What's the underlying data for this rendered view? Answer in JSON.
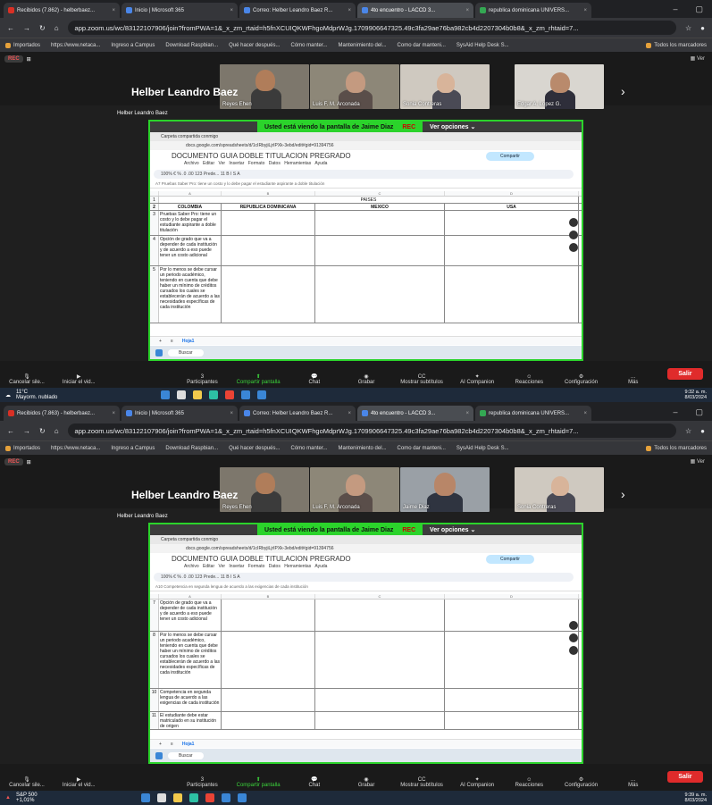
{
  "tabs": [
    {
      "label": "Recibidos (7.862) - helberbaez..."
    },
    {
      "label": "Inicio | Microsoft 365"
    },
    {
      "label": "Correo: Helber Leandro Baez R..."
    },
    {
      "label": "4to encuentro - LACCD 3..."
    },
    {
      "label": "republica dominicana UNIVERS..."
    }
  ],
  "tabs2": [
    {
      "label": "Recibidos (7.863) - helberbaez..."
    },
    {
      "label": "Inicio | Microsoft 365"
    },
    {
      "label": "Correo: Helber Leandro Baez R..."
    },
    {
      "label": "4to encuentro - LACCD 3..."
    },
    {
      "label": "republica dominicana UNIVERS..."
    }
  ],
  "url": "app.zoom.us/wc/83122107906/join?fromPWA=1&_x_zm_rtaid=h5fnXCUIQKWFhgoMdprWJg.1709906647325.49c3fa29ae76ba982cb4d2207304b0b8&_x_zm_rhtaid=7...",
  "bookmarks": [
    "Importados",
    "https://www.netaca...",
    "Ingreso a Campus",
    "Download Raspbian...",
    "Qué hacer después...",
    "Cómo manter...",
    "Mantenimiento del...",
    "Como dar manteni...",
    "SysAid Help Desk S...",
    "Todos los marcadores"
  ],
  "rec": "REC",
  "ver": "Ver",
  "host": "Helber Leandro Baez",
  "host_small": "Helber Leandro Baez",
  "tiles1": [
    "Reyes Ehen",
    "Luis F. M. Arconada",
    "Sonia Contreras",
    "Edgar A. Lopez G."
  ],
  "tiles2": [
    "Reyes Ehen",
    "Luis F. M. Arconada",
    "Jaime Diaz",
    "Sonia Contreras"
  ],
  "share_label": "Usted está viendo la pantalla de Jaime Diaz",
  "share_rec": "REC",
  "ver_opciones": "Ver opciones",
  "inner_tab": "Carpeta compartida conmigo",
  "inner_url": "docs.google.com/spreadsheets/d/1cIRbyjiLjrIPXk-3ebd/edit#gid=91394756",
  "doc_title": "DOCUMENTO GUIA DOBLE TITULACION PREGRADO",
  "doc_menu": "Archivo Editar Ver Insertar Formato Datos Herramientas Ayuda",
  "compartir": "Compartir",
  "toolbar": "100%   €   %   .0   .00   123   Prede...   11   B   I   S   A",
  "formula1": "A7  Pruebas Saber Pro: tiene un costo y lo debe pagar el estudiante aspirante a doble titulación",
  "formula2": "A10  Competencia en segunda lengua de acuerdo a las exigencias de cada institución",
  "col_letters": [
    "A",
    "B",
    "C",
    "D"
  ],
  "paises": "PAISES",
  "headers": [
    "COLOMBIA",
    "REPUBLICA DOMINICANA",
    "MEXICO",
    "USA"
  ],
  "rows1": [
    {
      "n": "3",
      "a": "Pruebas Saber Pro: tiene un costo y lo debe pagar el estudiante aspirante a doble titulación"
    },
    {
      "n": "4",
      "a": "Opción de grado que va a depender de cada institución y de acuerdo a eso puede tener un costo adicional"
    },
    {
      "n": "5",
      "a": "Por lo menos se debe cursar un periodo académico, teniendo en cuenta que debe haber un mínimo de créditos cursados los cuales se establecerán de acuerdo a las necesidades específicas de cada institución"
    }
  ],
  "rows2": [
    {
      "n": "7",
      "a": "Opción de grado que va a depender de cada institución y de acuerdo a eso puede tener un costo adicional"
    },
    {
      "n": "8",
      "a": "Por lo menos se debe cursar un periodo académico, teniendo en cuenta que debe haber un mínimo de créditos cursados los cuales se establecerán de acuerdo a las necesidades específicas de cada institución"
    },
    {
      "n": "10",
      "a": "Competencia en segunda lengua de acuerdo a las exigencias de cada institución"
    },
    {
      "n": "11",
      "a": "El estudiante debe estar matriculado en su institución de origen"
    }
  ],
  "sheet": "Hoja1",
  "search": "Buscar",
  "zoom_controls": {
    "cancel": "Cancelar sile...",
    "video": "Iniciar el vid...",
    "participants": "Participantes",
    "participants_count": "3",
    "share": "Compartir pantalla",
    "chat": "Chat",
    "record": "Grabar",
    "captions": "Mostrar subtítulos",
    "companion": "AI Companion",
    "reactions": "Reacciones",
    "config": "Configuración",
    "more": "Más",
    "leave": "Salir"
  },
  "weather1": {
    "temp": "11°C",
    "desc": "Mayorm. nublado"
  },
  "weather2": {
    "temp": "S&P 500",
    "desc": "+1,01%"
  },
  "clock1": {
    "time": "9:32 a. m.",
    "date": "8/03/2024"
  },
  "clock2": {
    "time": "9:39 a. m.",
    "date": "8/03/2024"
  }
}
